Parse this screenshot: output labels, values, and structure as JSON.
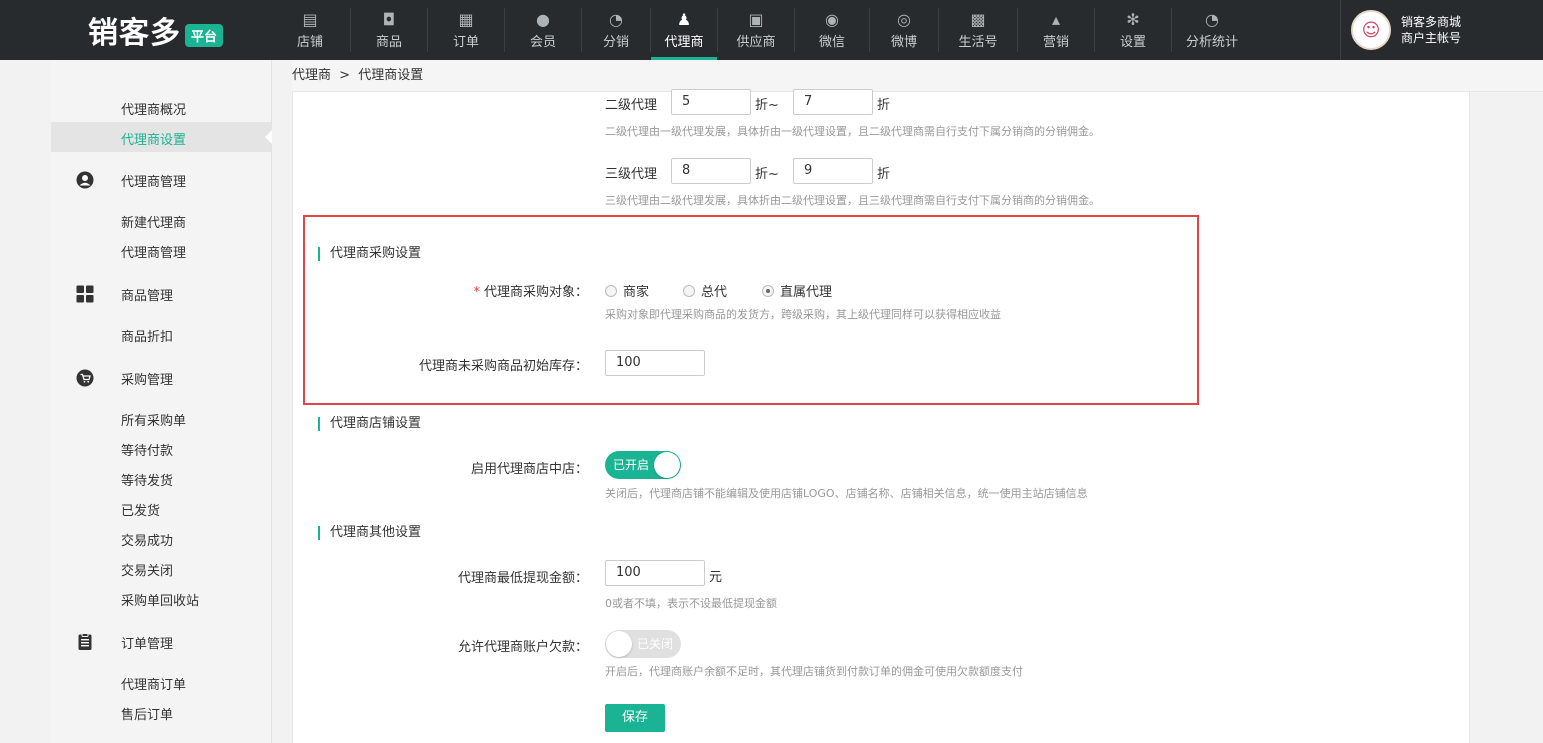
{
  "header": {
    "logo_text": "销客多",
    "logo_badge": "平台",
    "nav": [
      {
        "icon": "store-icon",
        "glyph": "▤",
        "label": "店铺"
      },
      {
        "icon": "goods-icon",
        "glyph": "◘",
        "label": "商品"
      },
      {
        "icon": "order-icon",
        "glyph": "▦",
        "label": "订单"
      },
      {
        "icon": "member-icon",
        "glyph": "●",
        "label": "会员"
      },
      {
        "icon": "distribution-icon",
        "glyph": "◔",
        "label": "分销"
      },
      {
        "icon": "agent-icon",
        "glyph": "♟",
        "label": "代理商",
        "active": true
      },
      {
        "icon": "supplier-icon",
        "glyph": "▣",
        "label": "供应商"
      },
      {
        "icon": "wechat-icon",
        "glyph": "◉",
        "label": "微信"
      },
      {
        "icon": "weibo-icon",
        "glyph": "◎",
        "label": "微博"
      },
      {
        "icon": "life-icon",
        "glyph": "▩",
        "label": "生活号"
      },
      {
        "icon": "marketing-icon",
        "glyph": "▴",
        "label": "营销"
      },
      {
        "icon": "settings-icon",
        "glyph": "✻",
        "label": "设置"
      },
      {
        "icon": "analytics-icon",
        "glyph": "◔",
        "label": "分析统计"
      }
    ],
    "account": {
      "name": "销客多商城",
      "role": "商户主帐号"
    }
  },
  "sidebar": {
    "top_items": [
      "代理商概况",
      "代理商设置"
    ],
    "groups": [
      {
        "icon": "agent-manage-icon",
        "label": "代理商管理",
        "items": [
          "新建代理商",
          "代理商管理"
        ]
      },
      {
        "icon": "goods-manage-icon",
        "label": "商品管理",
        "items": [
          "商品折扣"
        ]
      },
      {
        "icon": "purchase-manage-icon",
        "label": "采购管理",
        "items": [
          "所有采购单",
          "等待付款",
          "等待发货",
          "已发货",
          "交易成功",
          "交易关闭",
          "采购单回收站"
        ]
      },
      {
        "icon": "order-manage-icon",
        "label": "订单管理",
        "items": [
          "代理商订单",
          "售后订单"
        ]
      }
    ]
  },
  "breadcrumb": {
    "root": "代理商",
    "sep": ">",
    "current": "代理商设置"
  },
  "form": {
    "level2": {
      "label": "二级代理",
      "from": "5",
      "to": "7",
      "mid": "折~",
      "unit": "折",
      "hint": "二级代理由一级代理发展，具体折由一级代理设置，且二级代理商需自行支付下属分销商的分销佣金。"
    },
    "level3": {
      "label": "三级代理",
      "from": "8",
      "to": "9",
      "mid": "折~",
      "unit": "折",
      "hint": "三级代理由二级代理发展，具体折由二级代理设置，且三级代理商需自行支付下属分销商的分销佣金。"
    },
    "purchase": {
      "title": "代理商采购设置",
      "target_label": "代理商采购对象：",
      "required_mark": "*",
      "options": [
        "商家",
        "总代",
        "直属代理"
      ],
      "selected": "直属代理",
      "target_hint": "采购对象即代理采购商品的发货方，跨级采购，其上级代理同样可以获得相应收益",
      "stock_label": "代理商未采购商品初始库存：",
      "stock_value": "100"
    },
    "store": {
      "title": "代理商店铺设置",
      "enable_label": "启用代理商店中店：",
      "enable_state": "已开启",
      "enable_hint": "关闭后，代理商店铺不能编辑及使用店铺LOGO、店铺名称、店铺相关信息，统一使用主站店铺信息"
    },
    "other": {
      "title": "代理商其他设置",
      "min_withdraw_label": "代理商最低提现金额：",
      "min_withdraw_value": "100",
      "min_withdraw_unit": "元",
      "min_withdraw_hint": "0或者不填，表示不设最低提现金额",
      "debt_label": "允许代理商账户欠款：",
      "debt_state": "已关闭",
      "debt_hint": "开启后，代理商账户余额不足时，其代理店铺货到付款订单的佣金可使用欠款额度支付"
    },
    "save_label": "保存"
  },
  "colors": {
    "accent": "#1ab394",
    "topbar": "#272b2e",
    "highlight": "#e24545"
  }
}
